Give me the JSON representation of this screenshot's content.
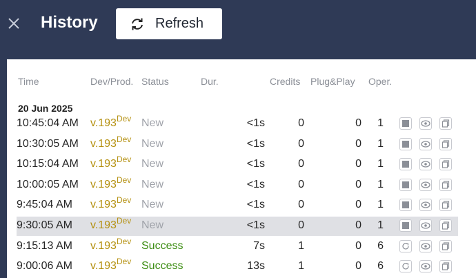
{
  "header": {
    "title": "History",
    "refresh_label": "Refresh"
  },
  "columns": {
    "time": "Time",
    "dev": "Dev/Prod.",
    "status": "Status",
    "dur": "Dur.",
    "credits": "Credits",
    "plug": "Plug&Play",
    "oper": "Oper."
  },
  "date_group": "20 Jun 2025",
  "rows": [
    {
      "time": "10:45:04 AM",
      "version": "v.193",
      "env": "Dev",
      "status": "New",
      "dur": "<1s",
      "credits": "0",
      "plug": "0",
      "oper": "1",
      "first_action": "stop"
    },
    {
      "time": "10:30:05 AM",
      "version": "v.193",
      "env": "Dev",
      "status": "New",
      "dur": "<1s",
      "credits": "0",
      "plug": "0",
      "oper": "1",
      "first_action": "stop"
    },
    {
      "time": "10:15:04 AM",
      "version": "v.193",
      "env": "Dev",
      "status": "New",
      "dur": "<1s",
      "credits": "0",
      "plug": "0",
      "oper": "1",
      "first_action": "stop"
    },
    {
      "time": "10:00:05 AM",
      "version": "v.193",
      "env": "Dev",
      "status": "New",
      "dur": "<1s",
      "credits": "0",
      "plug": "0",
      "oper": "1",
      "first_action": "stop"
    },
    {
      "time": "9:45:04 AM",
      "version": "v.193",
      "env": "Dev",
      "status": "New",
      "dur": "<1s",
      "credits": "0",
      "plug": "0",
      "oper": "1",
      "first_action": "stop"
    },
    {
      "time": "9:30:05 AM",
      "version": "v.193",
      "env": "Dev",
      "status": "New",
      "dur": "<1s",
      "credits": "0",
      "plug": "0",
      "oper": "1",
      "first_action": "stop",
      "selected": true
    },
    {
      "time": "9:15:13 AM",
      "version": "v.193",
      "env": "Dev",
      "status": "Success",
      "dur": "7s",
      "credits": "1",
      "plug": "0",
      "oper": "6",
      "first_action": "rerun"
    },
    {
      "time": "9:00:06 AM",
      "version": "v.193",
      "env": "Dev",
      "status": "Success",
      "dur": "13s",
      "credits": "1",
      "plug": "0",
      "oper": "6",
      "first_action": "rerun"
    }
  ]
}
